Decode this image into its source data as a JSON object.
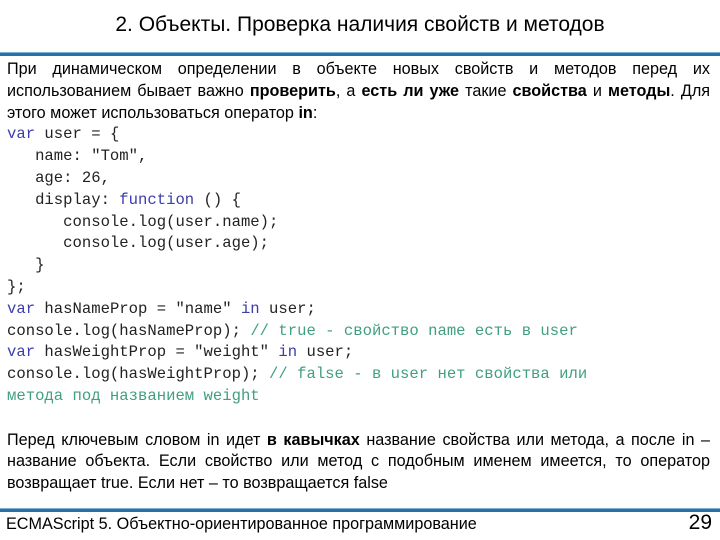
{
  "slide": {
    "title": "2. Объекты. Проверка наличия свойств и методов",
    "accent_color": "#2a6fa6",
    "intro": {
      "segments": [
        {
          "text": "При динамическом определении в объекте новых свойств и методов перед их использованием бывает важно ",
          "bold": false
        },
        {
          "text": "проверить",
          "bold": true
        },
        {
          "text": ", а ",
          "bold": false
        },
        {
          "text": "есть ли уже",
          "bold": true
        },
        {
          "text": " такие ",
          "bold": false
        },
        {
          "text": "свойства",
          "bold": true
        },
        {
          "text": " и ",
          "bold": false
        },
        {
          "text": "методы",
          "bold": true
        },
        {
          "text": ". Для этого может использоваться оператор ",
          "bold": false
        },
        {
          "text": "in",
          "bold": true
        },
        {
          "text": ":",
          "bold": false
        }
      ]
    },
    "code": {
      "keyword_color": "#3c3cab",
      "comment_color": "#3f9f80",
      "lines": [
        [
          {
            "t": "var",
            "c": "kw"
          },
          {
            "t": " user = {",
            "c": ""
          }
        ],
        [
          {
            "t": "   name: \"Tom\",",
            "c": ""
          }
        ],
        [
          {
            "t": "   age: 26,",
            "c": ""
          }
        ],
        [
          {
            "t": "   display: ",
            "c": ""
          },
          {
            "t": "function",
            "c": "kw"
          },
          {
            "t": " () {",
            "c": ""
          }
        ],
        [
          {
            "t": "      console.log(user.name);",
            "c": ""
          }
        ],
        [
          {
            "t": "      console.log(user.age);",
            "c": ""
          }
        ],
        [
          {
            "t": "   }",
            "c": ""
          }
        ],
        [
          {
            "t": "};",
            "c": ""
          }
        ],
        [
          {
            "t": "var",
            "c": "kw"
          },
          {
            "t": " hasNameProp = \"name\" ",
            "c": ""
          },
          {
            "t": "in",
            "c": "kw"
          },
          {
            "t": " user;",
            "c": ""
          }
        ],
        [
          {
            "t": "console.log(hasNameProp); ",
            "c": ""
          },
          {
            "t": "// true - свойство name есть в user",
            "c": "cm"
          }
        ],
        [
          {
            "t": "var",
            "c": "kw"
          },
          {
            "t": " hasWeightProp = \"weight\" ",
            "c": ""
          },
          {
            "t": "in",
            "c": "kw"
          },
          {
            "t": " user;",
            "c": ""
          }
        ],
        [
          {
            "t": "console.log(hasWeightProp); ",
            "c": ""
          },
          {
            "t": "// false - в user нет свойства или",
            "c": "cm"
          }
        ],
        [
          {
            "t": "метода под названием weight",
            "c": "cm"
          }
        ]
      ]
    },
    "outro": {
      "segments": [
        {
          "text": "Перед ключевым словом in идет ",
          "bold": false
        },
        {
          "text": "в кавычках",
          "bold": true
        },
        {
          "text": " название свойства или метода, а после in – название объекта. Если свойство или метод с подобным именем имеется, то оператор возвращает true. Если нет – то возвращается false",
          "bold": false
        }
      ]
    },
    "footer": {
      "text": "ECMAScript 5. Объектно-ориентированное программирование",
      "page_number": "29"
    }
  }
}
